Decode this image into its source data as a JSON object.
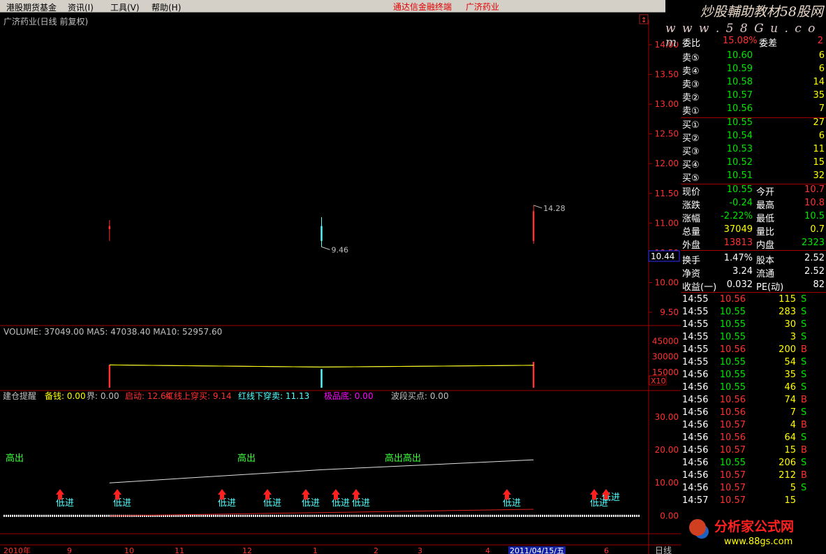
{
  "menu": {
    "items": [
      "港股期货基金",
      "资讯(I)",
      "工具(V)",
      "帮助(H)"
    ],
    "center_title": "通达信金融终端",
    "stock_title": "广济药业"
  },
  "watermark": {
    "top": "炒股輔助教材58股网",
    "url": "w w w . 5 8 G u . c o m",
    "bottom": "分析家公式网",
    "bottom_url": "www.88gs.com"
  },
  "chart_data": [
    {
      "type": "candlestick",
      "title": "广济药业(日线 前复权)",
      "y_ticks": [
        "14.00",
        "13.50",
        "13.00",
        "12.50",
        "12.00",
        "11.50",
        "11.00",
        "10.50",
        "10.00",
        "9.50"
      ],
      "ylim": [
        9.3,
        14.4
      ],
      "current_price": "10.44",
      "annotations": {
        "high": "14.28",
        "low": "9.46"
      },
      "colors": {
        "up": "#ff3232",
        "down": "#54ffff"
      }
    },
    {
      "type": "bar",
      "title": "VOLUME: 37049.00  MA5: 47038.40  MA10: 52957.60",
      "y_ticks": [
        "45000",
        "30000",
        "15000"
      ],
      "unit_label": "X10",
      "ylim": [
        0,
        52000
      ]
    },
    {
      "type": "line",
      "legend": [
        {
          "label": "建仓提醒",
          "color": "#c0c0c0"
        },
        {
          "label": "备钱: 0.00",
          "color": "#ffff00"
        },
        {
          "label": "界: 0.00",
          "color": "#c0c0c0"
        },
        {
          "label": "启动: 12.64",
          "color": "#ff3232"
        },
        {
          "label": "红线上穿买: 9.14",
          "color": "#ff3232"
        },
        {
          "label": "红线下穿卖: 11.13",
          "color": "#54ffff"
        },
        {
          "label": "极品底: 0.00",
          "color": "#ff00ff"
        },
        {
          "label": "波段买点: 0.00",
          "color": "#c0c0c0"
        }
      ],
      "y_ticks": [
        "30.00",
        "20.00",
        "10.00",
        "0.00"
      ],
      "ylim": [
        -5,
        34
      ],
      "signal_labels": [
        "高出",
        "高出",
        "高出高出",
        "低进",
        "低进",
        "低进",
        "低进",
        "低进",
        "低进",
        "低进",
        "低进",
        "低进",
        "低进"
      ]
    }
  ],
  "x_axis": {
    "labels": [
      "2010年",
      "9",
      "10",
      "11",
      "12",
      "1",
      "2",
      "3",
      "4",
      "2011/04/15/五",
      "6"
    ],
    "period": "日线"
  },
  "series": {
    "candles": [
      [
        10.9,
        11.05,
        10.7,
        10.95
      ],
      [
        10.95,
        11.1,
        10.6,
        10.7
      ],
      [
        10.7,
        11.3,
        10.65,
        11.2
      ]
    ],
    "volume": [
      22000,
      18000,
      25000
    ],
    "osc": [
      [
        0,
        10
      ],
      [
        1,
        14
      ],
      [
        2,
        17
      ]
    ]
  },
  "quote": {
    "weibi": {
      "label": "委比",
      "value": "15.08%",
      "label2": "委差",
      "value2": "2"
    },
    "asks": [
      {
        "label": "卖⑤",
        "price": "10.60",
        "vol": "6"
      },
      {
        "label": "卖④",
        "price": "10.59",
        "vol": "6"
      },
      {
        "label": "卖③",
        "price": "10.58",
        "vol": "14"
      },
      {
        "label": "卖②",
        "price": "10.57",
        "vol": "35"
      },
      {
        "label": "卖①",
        "price": "10.56",
        "vol": "7"
      }
    ],
    "bids": [
      {
        "label": "买①",
        "price": "10.55",
        "vol": "27"
      },
      {
        "label": "买②",
        "price": "10.54",
        "vol": "6"
      },
      {
        "label": "买③",
        "price": "10.53",
        "vol": "11"
      },
      {
        "label": "买④",
        "price": "10.52",
        "vol": "15"
      },
      {
        "label": "买⑤",
        "price": "10.51",
        "vol": "32"
      }
    ],
    "stats": [
      {
        "l1": "现价",
        "v1": "10.55",
        "c1": "grn",
        "l2": "今开",
        "v2": "10.7",
        "c2": "red"
      },
      {
        "l1": "涨跌",
        "v1": "-0.24",
        "c1": "grn",
        "l2": "最高",
        "v2": "10.8",
        "c2": "red"
      },
      {
        "l1": "涨幅",
        "v1": "-2.22%",
        "c1": "grn",
        "l2": "最低",
        "v2": "10.5",
        "c2": "grn"
      },
      {
        "l1": "总量",
        "v1": "37049",
        "c1": "yel",
        "l2": "量比",
        "v2": "0.7",
        "c2": "yel"
      },
      {
        "l1": "外盘",
        "v1": "13813",
        "c1": "red",
        "l2": "内盘",
        "v2": "2323",
        "c2": "grn"
      },
      {
        "l1": "换手",
        "v1": "1.47%",
        "c1": "wht",
        "l2": "股本",
        "v2": "2.52",
        "c2": "wht"
      },
      {
        "l1": "净资",
        "v1": "3.24",
        "c1": "wht",
        "l2": "流通",
        "v2": "2.52",
        "c2": "wht"
      },
      {
        "l1": "收益(一)",
        "v1": "0.032",
        "c1": "wht",
        "l2": "PE(动)",
        "v2": "82",
        "c2": "wht"
      }
    ],
    "ticks": [
      {
        "t": "14:55",
        "p": "10.56",
        "pc": "red",
        "v": "115",
        "bs": "S"
      },
      {
        "t": "14:55",
        "p": "10.55",
        "pc": "grn",
        "v": "283",
        "bs": "S"
      },
      {
        "t": "14:55",
        "p": "10.55",
        "pc": "grn",
        "v": "30",
        "bs": "S"
      },
      {
        "t": "14:55",
        "p": "10.55",
        "pc": "grn",
        "v": "3",
        "bs": "S"
      },
      {
        "t": "14:55",
        "p": "10.56",
        "pc": "red",
        "v": "200",
        "bs": "B"
      },
      {
        "t": "14:55",
        "p": "10.55",
        "pc": "grn",
        "v": "54",
        "bs": "S"
      },
      {
        "t": "14:56",
        "p": "10.55",
        "pc": "grn",
        "v": "35",
        "bs": "S"
      },
      {
        "t": "14:56",
        "p": "10.55",
        "pc": "grn",
        "v": "46",
        "bs": "S"
      },
      {
        "t": "14:56",
        "p": "10.56",
        "pc": "red",
        "v": "74",
        "bs": "B"
      },
      {
        "t": "14:56",
        "p": "10.56",
        "pc": "red",
        "v": "7",
        "bs": "S"
      },
      {
        "t": "14:56",
        "p": "10.57",
        "pc": "red",
        "v": "4",
        "bs": "B"
      },
      {
        "t": "14:56",
        "p": "10.56",
        "pc": "red",
        "v": "64",
        "bs": "S"
      },
      {
        "t": "14:56",
        "p": "10.57",
        "pc": "red",
        "v": "15",
        "bs": "B"
      },
      {
        "t": "14:56",
        "p": "10.55",
        "pc": "grn",
        "v": "206",
        "bs": "S"
      },
      {
        "t": "14:56",
        "p": "10.57",
        "pc": "red",
        "v": "212",
        "bs": "B"
      },
      {
        "t": "14:56",
        "p": "10.57",
        "pc": "red",
        "v": "5",
        "bs": "S"
      },
      {
        "t": "14:57",
        "p": "10.57",
        "pc": "red",
        "v": "15",
        "bs": ""
      }
    ]
  }
}
